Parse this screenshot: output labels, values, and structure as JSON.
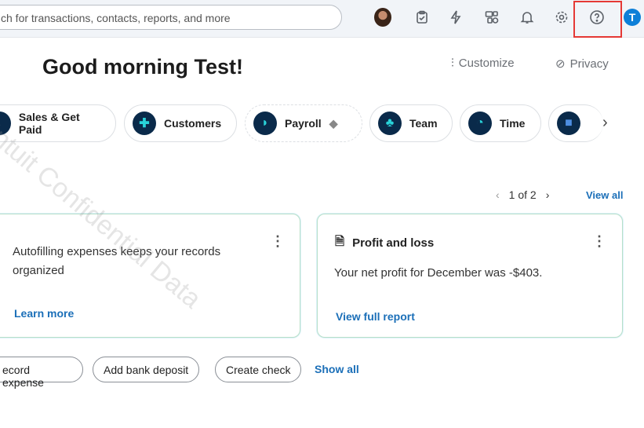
{
  "search": {
    "placeholder": "ch for transactions, contacts, reports, and more"
  },
  "user": {
    "initial": "T"
  },
  "greeting": "Good morning Test!",
  "toolbar": {
    "customize": "Customize",
    "privacy": "Privacy"
  },
  "chips": [
    "Sales & Get Paid",
    "Customers",
    "Payroll",
    "Team",
    "Time"
  ],
  "pager": {
    "text": "1 of 2",
    "view_all": "View all"
  },
  "cards": [
    {
      "text": "Autofilling expenses keeps your records organized",
      "link": "Learn more"
    },
    {
      "title": "Profit and loss",
      "text": "Your net profit for December was -$403.",
      "link": "View full report"
    }
  ],
  "actions": [
    "ecord expense",
    "Add bank deposit",
    "Create check"
  ],
  "show_all": "Show all",
  "watermark": "Intuit Confidential Data"
}
